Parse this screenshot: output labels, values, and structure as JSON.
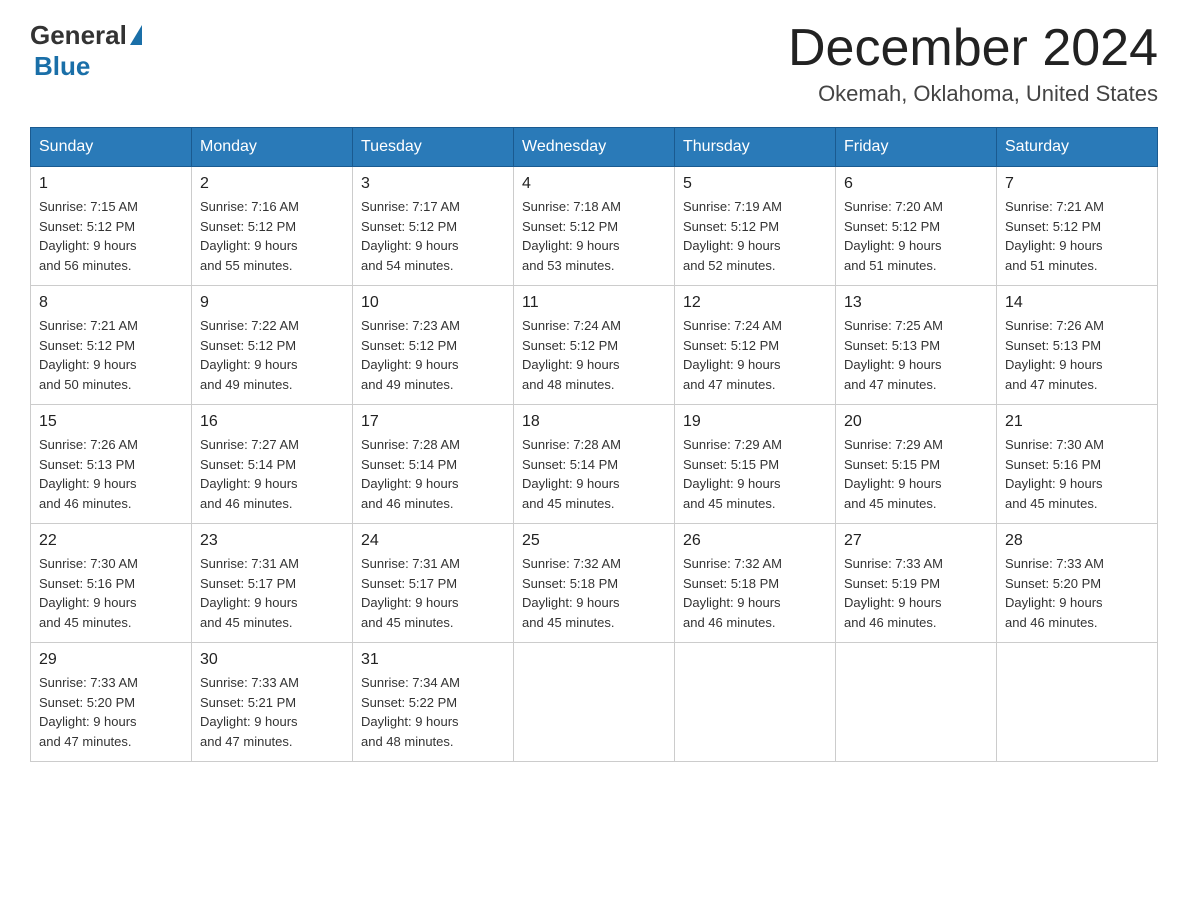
{
  "header": {
    "logo_general": "General",
    "logo_blue": "Blue",
    "month": "December 2024",
    "location": "Okemah, Oklahoma, United States"
  },
  "days_of_week": [
    "Sunday",
    "Monday",
    "Tuesday",
    "Wednesday",
    "Thursday",
    "Friday",
    "Saturday"
  ],
  "weeks": [
    [
      {
        "day": "1",
        "sunrise": "7:15 AM",
        "sunset": "5:12 PM",
        "daylight": "9 hours and 56 minutes."
      },
      {
        "day": "2",
        "sunrise": "7:16 AM",
        "sunset": "5:12 PM",
        "daylight": "9 hours and 55 minutes."
      },
      {
        "day": "3",
        "sunrise": "7:17 AM",
        "sunset": "5:12 PM",
        "daylight": "9 hours and 54 minutes."
      },
      {
        "day": "4",
        "sunrise": "7:18 AM",
        "sunset": "5:12 PM",
        "daylight": "9 hours and 53 minutes."
      },
      {
        "day": "5",
        "sunrise": "7:19 AM",
        "sunset": "5:12 PM",
        "daylight": "9 hours and 52 minutes."
      },
      {
        "day": "6",
        "sunrise": "7:20 AM",
        "sunset": "5:12 PM",
        "daylight": "9 hours and 51 minutes."
      },
      {
        "day": "7",
        "sunrise": "7:21 AM",
        "sunset": "5:12 PM",
        "daylight": "9 hours and 51 minutes."
      }
    ],
    [
      {
        "day": "8",
        "sunrise": "7:21 AM",
        "sunset": "5:12 PM",
        "daylight": "9 hours and 50 minutes."
      },
      {
        "day": "9",
        "sunrise": "7:22 AM",
        "sunset": "5:12 PM",
        "daylight": "9 hours and 49 minutes."
      },
      {
        "day": "10",
        "sunrise": "7:23 AM",
        "sunset": "5:12 PM",
        "daylight": "9 hours and 49 minutes."
      },
      {
        "day": "11",
        "sunrise": "7:24 AM",
        "sunset": "5:12 PM",
        "daylight": "9 hours and 48 minutes."
      },
      {
        "day": "12",
        "sunrise": "7:24 AM",
        "sunset": "5:12 PM",
        "daylight": "9 hours and 47 minutes."
      },
      {
        "day": "13",
        "sunrise": "7:25 AM",
        "sunset": "5:13 PM",
        "daylight": "9 hours and 47 minutes."
      },
      {
        "day": "14",
        "sunrise": "7:26 AM",
        "sunset": "5:13 PM",
        "daylight": "9 hours and 47 minutes."
      }
    ],
    [
      {
        "day": "15",
        "sunrise": "7:26 AM",
        "sunset": "5:13 PM",
        "daylight": "9 hours and 46 minutes."
      },
      {
        "day": "16",
        "sunrise": "7:27 AM",
        "sunset": "5:14 PM",
        "daylight": "9 hours and 46 minutes."
      },
      {
        "day": "17",
        "sunrise": "7:28 AM",
        "sunset": "5:14 PM",
        "daylight": "9 hours and 46 minutes."
      },
      {
        "day": "18",
        "sunrise": "7:28 AM",
        "sunset": "5:14 PM",
        "daylight": "9 hours and 45 minutes."
      },
      {
        "day": "19",
        "sunrise": "7:29 AM",
        "sunset": "5:15 PM",
        "daylight": "9 hours and 45 minutes."
      },
      {
        "day": "20",
        "sunrise": "7:29 AM",
        "sunset": "5:15 PM",
        "daylight": "9 hours and 45 minutes."
      },
      {
        "day": "21",
        "sunrise": "7:30 AM",
        "sunset": "5:16 PM",
        "daylight": "9 hours and 45 minutes."
      }
    ],
    [
      {
        "day": "22",
        "sunrise": "7:30 AM",
        "sunset": "5:16 PM",
        "daylight": "9 hours and 45 minutes."
      },
      {
        "day": "23",
        "sunrise": "7:31 AM",
        "sunset": "5:17 PM",
        "daylight": "9 hours and 45 minutes."
      },
      {
        "day": "24",
        "sunrise": "7:31 AM",
        "sunset": "5:17 PM",
        "daylight": "9 hours and 45 minutes."
      },
      {
        "day": "25",
        "sunrise": "7:32 AM",
        "sunset": "5:18 PM",
        "daylight": "9 hours and 45 minutes."
      },
      {
        "day": "26",
        "sunrise": "7:32 AM",
        "sunset": "5:18 PM",
        "daylight": "9 hours and 46 minutes."
      },
      {
        "day": "27",
        "sunrise": "7:33 AM",
        "sunset": "5:19 PM",
        "daylight": "9 hours and 46 minutes."
      },
      {
        "day": "28",
        "sunrise": "7:33 AM",
        "sunset": "5:20 PM",
        "daylight": "9 hours and 46 minutes."
      }
    ],
    [
      {
        "day": "29",
        "sunrise": "7:33 AM",
        "sunset": "5:20 PM",
        "daylight": "9 hours and 47 minutes."
      },
      {
        "day": "30",
        "sunrise": "7:33 AM",
        "sunset": "5:21 PM",
        "daylight": "9 hours and 47 minutes."
      },
      {
        "day": "31",
        "sunrise": "7:34 AM",
        "sunset": "5:22 PM",
        "daylight": "9 hours and 48 minutes."
      },
      null,
      null,
      null,
      null
    ]
  ],
  "labels": {
    "sunrise": "Sunrise: ",
    "sunset": "Sunset: ",
    "daylight": "Daylight: "
  }
}
